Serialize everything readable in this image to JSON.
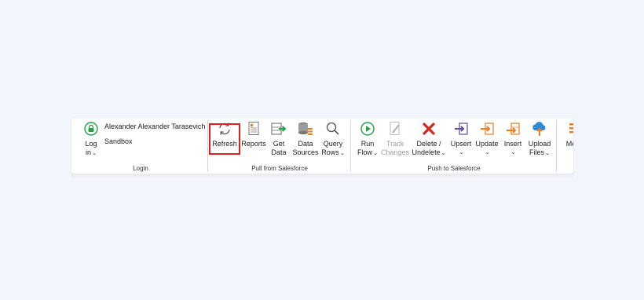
{
  "login": {
    "user_name": "Alexander Alexander Tarasevich",
    "environment": "Sandbox",
    "login_button": {
      "line1": "Log",
      "line2": "in",
      "icon": "lock-icon"
    },
    "group_label": "Login"
  },
  "pull": {
    "group_label": "Pull from Salesforce",
    "refresh": {
      "label": "Refresh",
      "icon": "refresh-icon",
      "highlighted": true
    },
    "reports": {
      "label": "Reports",
      "icon": "report-icon"
    },
    "get_data": {
      "line1": "Get",
      "line2": "Data",
      "icon": "get-data-icon"
    },
    "data_sources": {
      "line1": "Data",
      "line2": "Sources",
      "icon": "database-icon"
    },
    "query": {
      "line1": "Query",
      "line2": "Rows",
      "icon": "search-icon"
    }
  },
  "push": {
    "group_label": "Push to Salesforce",
    "run_flow": {
      "line1": "Run",
      "line2": "Flow",
      "icon": "play-icon"
    },
    "track_changes": {
      "line1": "Track",
      "line2": "Changes",
      "icon": "track-changes-icon",
      "disabled": true
    },
    "delete": {
      "line1": "Delete /",
      "line2": "Undelete",
      "icon": "delete-icon"
    },
    "upsert": {
      "label": "Upsert",
      "icon": "upsert-icon"
    },
    "update": {
      "label": "Update",
      "icon": "update-icon"
    },
    "insert": {
      "label": "Insert",
      "icon": "insert-icon"
    },
    "upload": {
      "line1": "Upload",
      "line2": "Files",
      "icon": "cloud-upload-icon"
    }
  },
  "more": {
    "label": "Me",
    "icon": "more-icon"
  },
  "caret_glyph": "⌄",
  "colors": {
    "highlight": "#e02020",
    "green": "#22a34a",
    "orange": "#ee7d22",
    "red": "#d9261c",
    "purple": "#5b4ea3",
    "blue": "#2a8cd6"
  }
}
